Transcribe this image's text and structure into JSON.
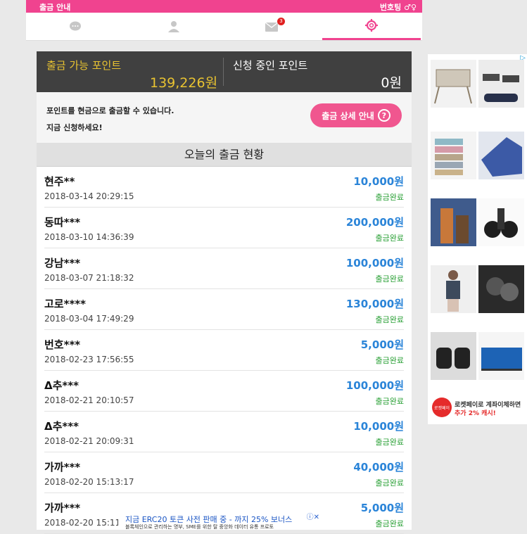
{
  "header": {
    "title": "출금 안내",
    "right_label": "번호팅 ♂♀"
  },
  "tabs": [
    {
      "icon": "chat-icon"
    },
    {
      "icon": "person-icon"
    },
    {
      "icon": "mail-icon",
      "badge": "3"
    },
    {
      "icon": "gear-icon",
      "active": true
    }
  ],
  "points": {
    "available_label": "출금 가능 포인트",
    "available_value": "139,226원",
    "pending_label": "신청 중인 포인트",
    "pending_value": "0원"
  },
  "info": {
    "line1": "포인트를 현금으로 출금할 수 있습니다.",
    "line2": "지금 신청하세요!",
    "button": "출금 상세 안내",
    "button_icon": "question-icon"
  },
  "today": {
    "title": "오늘의 출금 현황",
    "rows": [
      {
        "name": "현주**",
        "date": "2018-03-14 20:29:15",
        "amount": "10,000원",
        "status": "출금완료"
      },
      {
        "name": "동따***",
        "date": "2018-03-10 14:36:39",
        "amount": "200,000원",
        "status": "출금완료"
      },
      {
        "name": "강남***",
        "date": "2018-03-07 21:18:32",
        "amount": "100,000원",
        "status": "출금완료"
      },
      {
        "name": "고로****",
        "date": "2018-03-04 17:49:29",
        "amount": "130,000원",
        "status": "출금완료"
      },
      {
        "name": "번호***",
        "date": "2018-02-23 17:56:55",
        "amount": "5,000원",
        "status": "출금완료"
      },
      {
        "name": "Δ추***",
        "date": "2018-02-21 20:10:57",
        "amount": "100,000원",
        "status": "출금완료"
      },
      {
        "name": "Δ추***",
        "date": "2018-02-21 20:09:31",
        "amount": "10,000원",
        "status": "출금완료"
      },
      {
        "name": "가까***",
        "date": "2018-02-20 15:13:17",
        "amount": "40,000원",
        "status": "출금완료"
      },
      {
        "name": "가까***",
        "date": "2018-02-20 15:11:",
        "amount": "5,000원",
        "status": "출금완료"
      }
    ]
  },
  "ad_banner": {
    "line1": "지금 ERC20 토큰 사전 판매 중 - 까지 25% 보너스",
    "line2": "블록체인으로 관리하는 명부, SME를 위한 탈 중앙화 데이터 유통 프로토"
  },
  "side_ad": {
    "promo_logo": "로켓페이",
    "promo_line1": "로켓페이로 계좌이체하면",
    "promo_line2": "추가 2% 캐시!"
  },
  "colors": {
    "brand": "#f0438f",
    "amount": "#2a84d8",
    "status": "#2aa036",
    "points_bg": "#404040",
    "points_gold": "#e9c331"
  }
}
